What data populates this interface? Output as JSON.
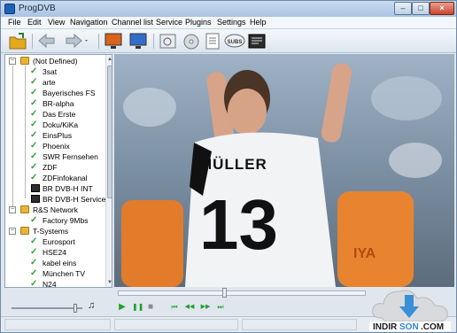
{
  "window": {
    "title": "ProgDVB"
  },
  "menu": [
    "File",
    "Edit",
    "View",
    "Navigation",
    "Channel list",
    "Service",
    "Plugins",
    "Settings",
    "Help"
  ],
  "toolbar": {
    "icons": [
      "open-folder-icon",
      "back-arrow-icon",
      "forward-arrow-icon",
      "tv-monitor-icon",
      "tv-monitor-blue-icon",
      "capture-icon",
      "disc-icon",
      "document-icon",
      "subtitles-icon",
      "teletext-icon"
    ],
    "subtitles_label": "SUBS"
  },
  "tree": {
    "groups": [
      {
        "label": "(Not Defined)",
        "channels": [
          "3sat",
          "arte",
          "Bayerisches FS",
          "BR-alpha",
          "Das Erste",
          "Doku/KiKa",
          "EinsPlus",
          "Phoenix",
          "SWR Fernsehen",
          "ZDF",
          "ZDFinfokanal",
          "BR DVB-H INT",
          "BR DVB-H Services"
        ]
      },
      {
        "label": "R&S Network",
        "channels": [
          "Factory 9Mbs"
        ]
      },
      {
        "label": "T-Systems",
        "channels": [
          "Eurosport",
          "HSE24",
          "kabel eins",
          "München TV",
          "N24"
        ]
      }
    ]
  },
  "video": {
    "jersey_name": "MÜLLER",
    "jersey_number": "13",
    "ad_board": "IYA"
  },
  "player": {
    "seek_fraction": 0.43,
    "volume_fraction": 0.95,
    "buttons": [
      "▶",
      "❚❚",
      "■",
      "⏮",
      "◀◀",
      "▶▶",
      "⏭"
    ]
  },
  "watermark": {
    "text_black": "INDIR",
    "text_blue": "SON",
    "text_tail": ".COM"
  },
  "colors": {
    "accent": "#1d62b8",
    "play_green": "#21a12c",
    "check_green": "#2fa12f",
    "folder": "#e7b43a"
  }
}
